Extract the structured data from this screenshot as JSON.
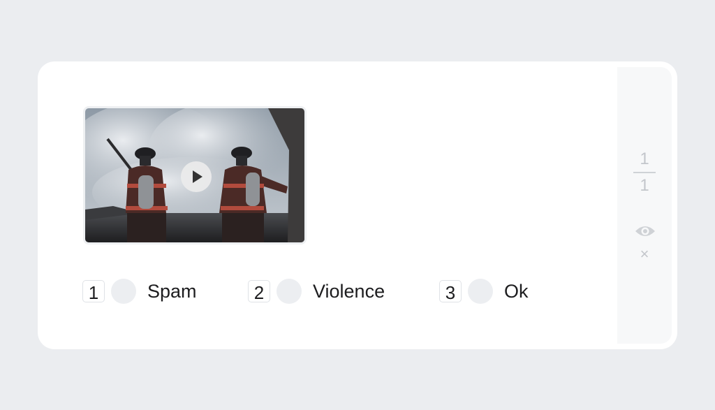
{
  "counter": {
    "current": "1",
    "total": "1"
  },
  "icons": {
    "eye": "eye-icon",
    "close": "close-icon",
    "play": "play-icon"
  },
  "media": {
    "type": "video",
    "description_icon": "play-icon"
  },
  "options": [
    {
      "key": "1",
      "label": "Spam"
    },
    {
      "key": "2",
      "label": "Violence"
    },
    {
      "key": "3",
      "label": "Ok"
    }
  ],
  "close_glyph": "×"
}
